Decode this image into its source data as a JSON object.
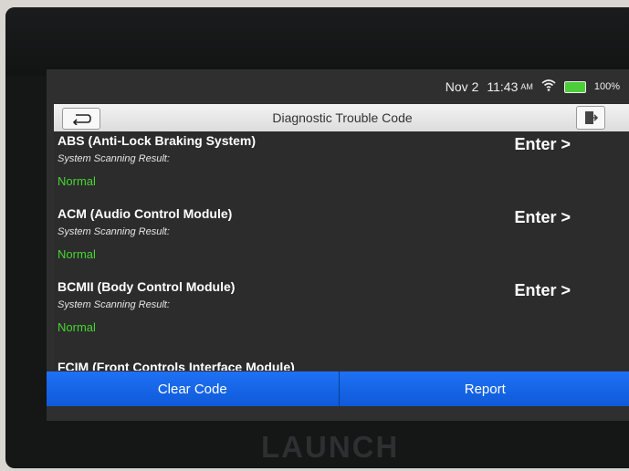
{
  "status_bar": {
    "date": "Nov 2",
    "time": "11:43",
    "ampm": "AM",
    "battery": "100%",
    "wifi_icon": "wifi-icon",
    "colors": {
      "battery": "#4ccd3a"
    }
  },
  "header": {
    "title": "Diagnostic Trouble Code",
    "back_icon": "back-arrow-icon",
    "exit_icon": "exit-icon"
  },
  "modules": [
    {
      "name": "ABS (Anti-Lock Braking System)",
      "subtitle": "System Scanning Result:",
      "status": "Normal",
      "action": "Enter >"
    },
    {
      "name": "ACM (Audio Control Module)",
      "subtitle": "System Scanning Result:",
      "status": "Normal",
      "action": "Enter >"
    },
    {
      "name": "BCMII (Body Control Module)",
      "subtitle": "System Scanning Result:",
      "status": "Normal",
      "action": "Enter >"
    },
    {
      "name": "FCIM (Front Controls Interface Module)"
    }
  ],
  "footer": {
    "clear_label": "Clear Code",
    "report_label": "Report",
    "colors": {
      "button": "#1f71f5"
    }
  },
  "device": {
    "brand": "LAUNCH"
  }
}
